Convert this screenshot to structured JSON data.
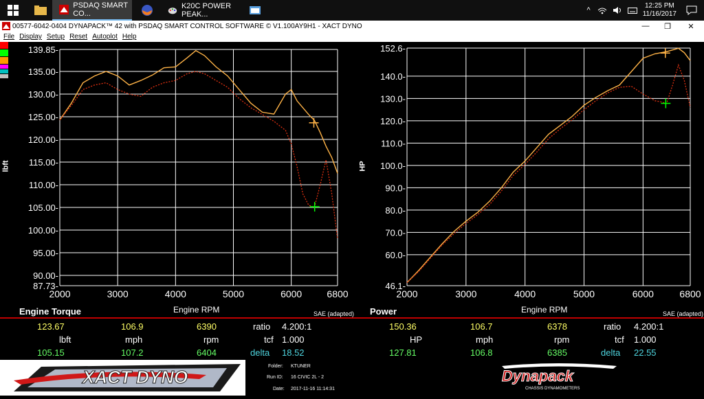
{
  "taskbar": {
    "items": [
      {
        "label": "PSDAQ SMART CO..."
      },
      {
        "label": "K20C POWER PEAK..."
      }
    ],
    "clock": {
      "time": "12:25 PM",
      "date": "11/16/2017"
    }
  },
  "window": {
    "title": "00577-6042-0404 DYNAPACK™ 42 with PSDAQ SMART CONTROL SOFTWARE © V1.100AY9H1 - XACT DYNO",
    "menu": [
      "File",
      "Display",
      "Setup",
      "Reset",
      "Autoplot",
      "Help"
    ]
  },
  "side_swatches": [
    "#ff0000",
    "#00ff00",
    "#ff9900",
    "#ff00ff",
    "#00c0c0",
    "#c0c0c0"
  ],
  "charts": {
    "torque": {
      "section_title": "Engine Torque",
      "ylabel": "lbft",
      "xlabel": "Engine RPM",
      "note": "SAE (adapted)",
      "yticks": [
        "139.85-",
        "135.00-",
        "130.00-",
        "125.00-",
        "120.00-",
        "115.00-",
        "110.00-",
        "105.00-",
        "100.00-",
        "95.00-",
        "90.00-",
        "87.73-"
      ],
      "xticks": [
        "2000",
        "3000",
        "4000",
        "5000",
        "6000",
        "6800"
      ]
    },
    "power": {
      "section_title": "Power",
      "ylabel": "HP",
      "xlabel": "Engine RPM",
      "note": "SAE (adapted)",
      "yticks": [
        "152.6-",
        "140.0-",
        "130.0-",
        "120.0-",
        "110.0-",
        "100.0-",
        "90.0-",
        "80.0-",
        "70.0-",
        "60.0-",
        "46.1-"
      ],
      "xticks": [
        "2000",
        "3000",
        "4000",
        "5000",
        "6000",
        "6800"
      ]
    }
  },
  "chart_data": [
    {
      "type": "line",
      "xlabel": "Engine RPM",
      "ylabel": "lbft",
      "xlim": [
        2000,
        6800
      ],
      "ylim": [
        87.73,
        139.85
      ],
      "grid": true,
      "series": [
        {
          "color": "#ffb347",
          "style": "solid",
          "x": [
            2000,
            2200,
            2400,
            2600,
            2800,
            3000,
            3200,
            3400,
            3600,
            3800,
            4000,
            4200,
            4350,
            4500,
            4700,
            4900,
            5100,
            5300,
            5500,
            5700,
            5900,
            6000,
            6100,
            6200,
            6300,
            6400,
            6500,
            6600,
            6700,
            6800
          ],
          "y": [
            124.3,
            128,
            132.5,
            134,
            135,
            134,
            132,
            133,
            134.2,
            135.8,
            136,
            138,
            139.6,
            138.5,
            136,
            134,
            131,
            128,
            126,
            125.6,
            130,
            131,
            128.5,
            127,
            125.5,
            124.2,
            121.5,
            118.5,
            116,
            112.5
          ]
        },
        {
          "color": "#e03010",
          "style": "dotted",
          "x": [
            2000,
            2200,
            2400,
            2600,
            2800,
            3000,
            3200,
            3400,
            3600,
            3800,
            4000,
            4200,
            4350,
            4500,
            4700,
            4900,
            5100,
            5300,
            5500,
            5700,
            5900,
            6000,
            6100,
            6200,
            6300,
            6400,
            6500,
            6600,
            6700,
            6800
          ],
          "y": [
            124.3,
            127.5,
            131,
            132,
            132.5,
            131,
            130,
            129.5,
            131.5,
            132.5,
            133,
            134.5,
            135,
            134.5,
            133,
            131.5,
            129,
            127,
            125.5,
            124,
            122,
            119,
            114,
            108,
            105.5,
            105,
            110,
            115.5,
            108,
            98
          ]
        }
      ],
      "markers": [
        {
          "color": "#ffb347",
          "x": 6390,
          "y": 123.67
        },
        {
          "color": "#00ff00",
          "x": 6404,
          "y": 105.15
        }
      ]
    },
    {
      "type": "line",
      "xlabel": "Engine RPM",
      "ylabel": "HP",
      "xlim": [
        2000,
        6800
      ],
      "ylim": [
        46.1,
        152.6
      ],
      "grid": true,
      "series": [
        {
          "color": "#ffb347",
          "style": "solid",
          "x": [
            2000,
            2200,
            2400,
            2600,
            2800,
            3000,
            3200,
            3400,
            3600,
            3800,
            4000,
            4200,
            4400,
            4600,
            4800,
            5000,
            5200,
            5400,
            5600,
            5800,
            6000,
            6200,
            6400,
            6600,
            6700,
            6800
          ],
          "y": [
            47.5,
            53,
            59,
            65,
            70.5,
            75,
            79,
            84,
            90,
            97,
            102,
            108,
            114,
            118,
            122,
            127,
            130.5,
            133.5,
            136,
            142,
            148,
            150,
            151,
            152.5,
            150.5,
            147
          ]
        },
        {
          "color": "#e03010",
          "style": "dotted",
          "x": [
            2000,
            2200,
            2400,
            2600,
            2800,
            3000,
            3200,
            3400,
            3600,
            3800,
            4000,
            4200,
            4400,
            4600,
            4800,
            5000,
            5200,
            5400,
            5600,
            5800,
            6000,
            6200,
            6300,
            6400,
            6500,
            6600,
            6700,
            6800
          ],
          "y": [
            47.5,
            52.5,
            58.5,
            64.5,
            69.5,
            74,
            78,
            82.5,
            88.5,
            95.5,
            100.5,
            106,
            112,
            116.5,
            120.5,
            125,
            129,
            132.5,
            135,
            135.5,
            132,
            129,
            128.5,
            127.8,
            136,
            145,
            138,
            126
          ]
        }
      ],
      "markers": [
        {
          "color": "#ffb347",
          "x": 6378,
          "y": 150.36
        },
        {
          "color": "#00ff00",
          "x": 6385,
          "y": 127.81
        }
      ]
    }
  ],
  "readouts": {
    "torque": {
      "row1": [
        "123.67",
        "106.9",
        "6390",
        "ratio",
        "4.200:1"
      ],
      "row2": [
        "lbft",
        "mph",
        "rpm",
        "tcf",
        "1.000"
      ],
      "row3": [
        "105.15",
        "107.2",
        "6404",
        "delta",
        "18.52"
      ]
    },
    "power": {
      "row1": [
        "150.36",
        "106.7",
        "6378",
        "ratio",
        "4.200:1"
      ],
      "row2": [
        "HP",
        "mph",
        "rpm",
        "tcf",
        "1.000"
      ],
      "row3": [
        "127.81",
        "106.8",
        "6385",
        "delta",
        "22.55"
      ]
    }
  },
  "run_info": {
    "folder_label": "Folder:",
    "folder": "KTUNER",
    "runid_label": "Run ID:",
    "runid": "16 CIVIC 2L - 2",
    "date_label": "Date:",
    "date": "2017-11-16 11:14:31"
  },
  "logos": {
    "left": "XACT DYNO",
    "right": "Dynapack",
    "right_sub": "CHASSIS DYNAMOMETERS"
  }
}
